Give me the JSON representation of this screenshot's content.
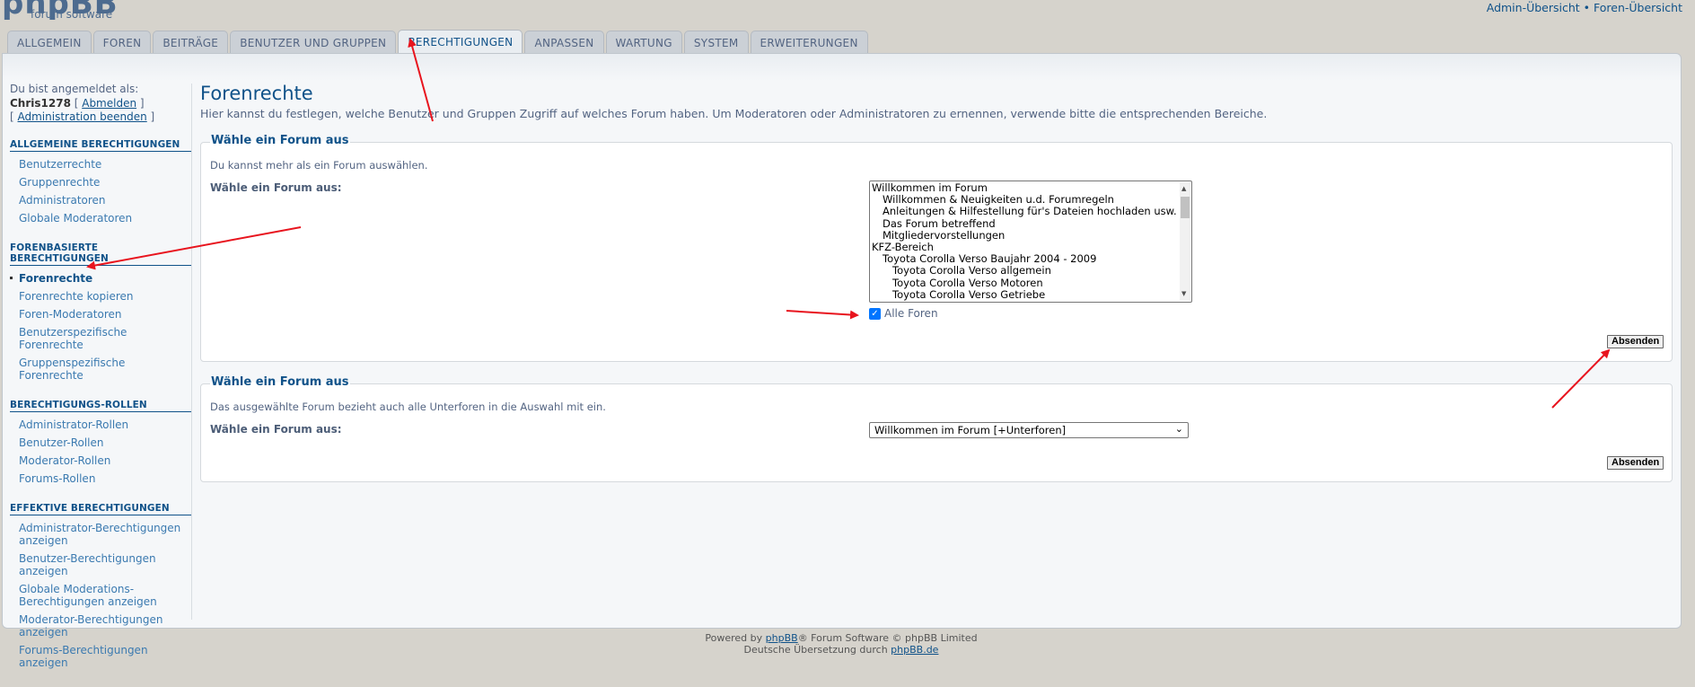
{
  "brand": {
    "logo_big": "phpBB",
    "logo_small": "forum software"
  },
  "top_links": {
    "admin": "Admin-Übersicht",
    "sep": " • ",
    "forum": "Foren-Übersicht"
  },
  "tabs": [
    {
      "label": "ALLGEMEIN"
    },
    {
      "label": "FOREN"
    },
    {
      "label": "BEITRÄGE"
    },
    {
      "label": "BENUTZER UND GRUPPEN"
    },
    {
      "label": "BERECHTIGUNGEN"
    },
    {
      "label": "ANPASSEN"
    },
    {
      "label": "WARTUNG"
    },
    {
      "label": "SYSTEM"
    },
    {
      "label": "ERWEITERUNGEN"
    }
  ],
  "login": {
    "logged_as": "Du bist angemeldet als:",
    "user": "Chris1278",
    "logout": "Abmelden",
    "end_admin": "Administration beenden"
  },
  "sidebar": [
    {
      "title": "ALLGEMEINE BERECHTIGUNGEN",
      "items": [
        {
          "label": "Benutzerrechte"
        },
        {
          "label": "Gruppenrechte"
        },
        {
          "label": "Administratoren"
        },
        {
          "label": "Globale Moderatoren"
        }
      ]
    },
    {
      "title": "FORENBASIERTE BERECHTIGUNGEN",
      "items": [
        {
          "label": "Forenrechte"
        },
        {
          "label": "Forenrechte kopieren"
        },
        {
          "label": "Foren-Moderatoren"
        },
        {
          "label": "Benutzerspezifische Forenrechte"
        },
        {
          "label": "Gruppenspezifische Forenrechte"
        }
      ]
    },
    {
      "title": "BERECHTIGUNGS-ROLLEN",
      "items": [
        {
          "label": "Administrator-Rollen"
        },
        {
          "label": "Benutzer-Rollen"
        },
        {
          "label": "Moderator-Rollen"
        },
        {
          "label": "Forums-Rollen"
        }
      ]
    },
    {
      "title": "EFFEKTIVE BERECHTIGUNGEN",
      "items": [
        {
          "label": "Administrator-Berechtigungen anzeigen"
        },
        {
          "label": "Benutzer-Berechtigungen anzeigen"
        },
        {
          "label": "Globale Moderations-Berechtigungen anzeigen"
        },
        {
          "label": "Moderator-Berechtigungen anzeigen"
        },
        {
          "label": "Forums-Berechtigungen anzeigen"
        }
      ]
    }
  ],
  "page": {
    "title": "Forenrechte",
    "description": "Hier kannst du festlegen, welche Benutzer und Gruppen Zugriff auf welches Forum haben. Um Moderatoren oder Administratoren zu ernennen, verwende bitte die entsprechenden Bereiche."
  },
  "box1": {
    "legend": "Wähle ein Forum aus",
    "explain": "Du kannst mehr als ein Forum auswählen.",
    "label": "Wähle ein Forum aus:",
    "options": [
      {
        "text": "Willkommen im Forum",
        "level": 0
      },
      {
        "text": "Willkommen & Neuigkeiten u.d. Forumregeln",
        "level": 1
      },
      {
        "text": "Anleitungen & Hilfestellung für's Dateien hochladen usw.",
        "level": 1
      },
      {
        "text": "Das Forum betreffend",
        "level": 1
      },
      {
        "text": "Mitgliedervorstellungen",
        "level": 1
      },
      {
        "text": "KFZ-Bereich",
        "level": 0
      },
      {
        "text": "Toyota Corolla Verso Baujahr 2004 - 2009",
        "level": 1
      },
      {
        "text": "Toyota Corolla Verso allgemein",
        "level": 2
      },
      {
        "text": "Toyota Corolla Verso Motoren",
        "level": 2
      },
      {
        "text": "Toyota Corolla Verso Getriebe",
        "level": 2
      }
    ],
    "all_forums": "Alle Foren",
    "all_forums_checked": true,
    "submit": "Absenden"
  },
  "box2": {
    "legend": "Wähle ein Forum aus",
    "explain": "Das ausgewählte Forum bezieht auch alle Unterforen in die Auswahl mit ein.",
    "label": "Wähle ein Forum aus:",
    "selected": "Willkommen im Forum [+Unterforen]",
    "submit": "Absenden"
  },
  "footer": {
    "powered_pre": "Powered by ",
    "powered_link": "phpBB",
    "powered_post": "® Forum Software © phpBB Limited",
    "translation_pre": "Deutsche Übersetzung durch ",
    "translation_link": "phpBB.de"
  },
  "colors": {
    "accent": "#105289",
    "link": "#3b7ab0",
    "annotation": "#e8141e"
  }
}
